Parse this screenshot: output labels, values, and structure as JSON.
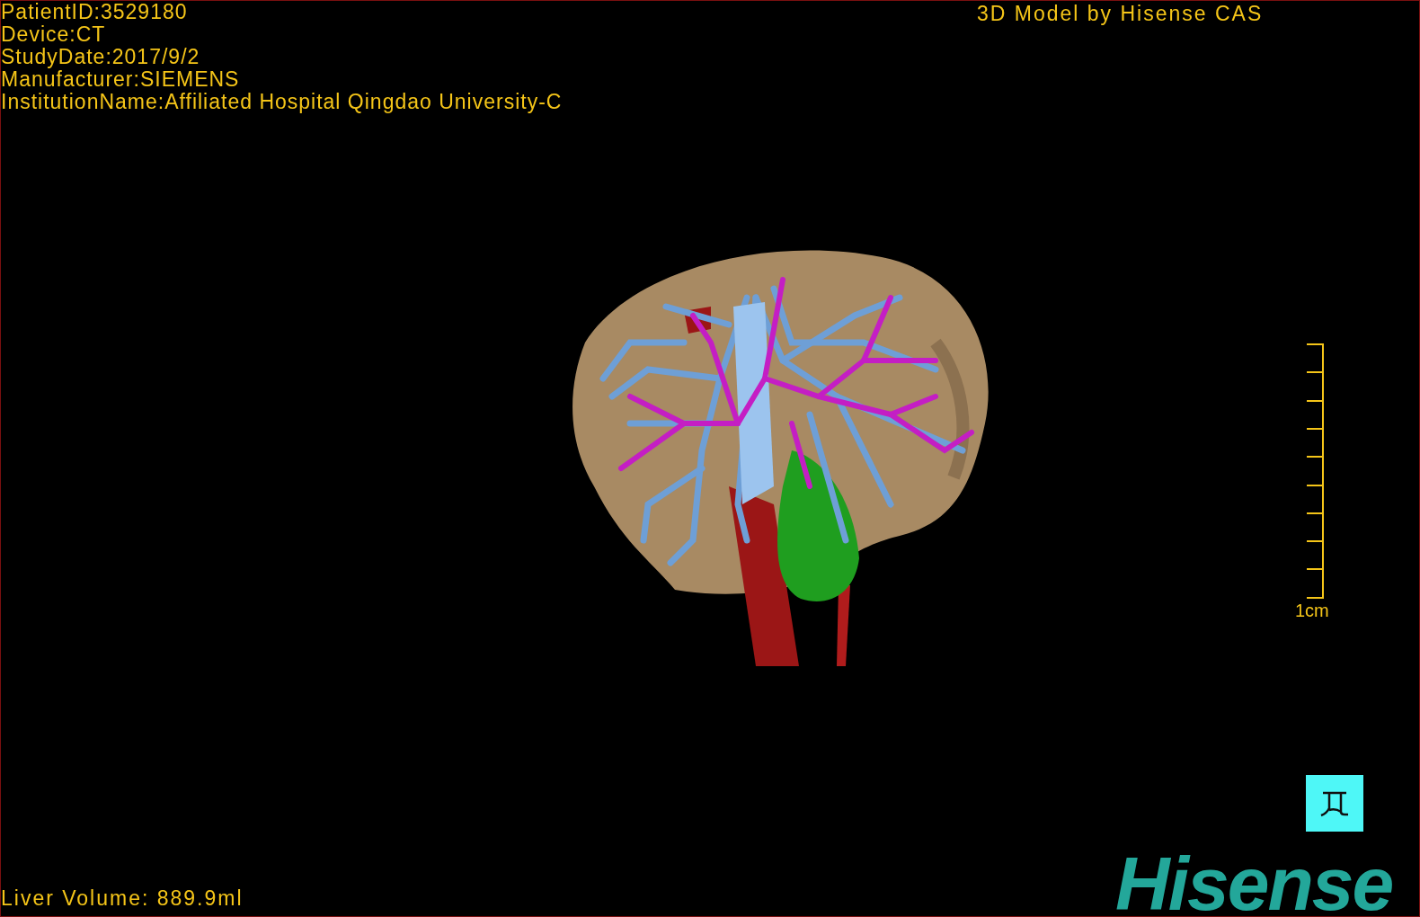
{
  "study_info": [
    "PatientID:3529180",
    "Device:CT",
    "StudyDate:2017/9/2",
    "Manufacturer:SIEMENS",
    "InstitutionName:Affiliated Hospital Qingdao University-C"
  ],
  "model_title": "3D Model by Hisense CAS",
  "scale_bar": {
    "label": "1cm"
  },
  "liver_volume": "Liver Volume: 889.9ml",
  "brand_logo": "Hisense"
}
